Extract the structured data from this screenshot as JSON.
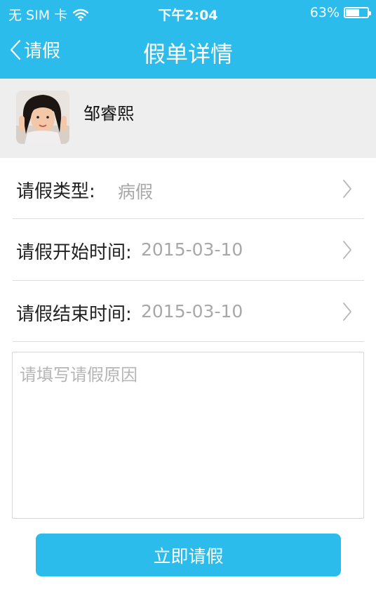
{
  "status_bar": {
    "carrier": "无 SIM 卡",
    "time": "下午2:04",
    "battery": "63%",
    "battery_level": 0.63
  },
  "nav": {
    "back_label": "请假",
    "title": "假单详情"
  },
  "user": {
    "name": "邹睿熙"
  },
  "form": {
    "type": {
      "label": "请假类型:",
      "value": "病假"
    },
    "start": {
      "label": "请假开始时间:",
      "value": "2015-03-10"
    },
    "end": {
      "label": "请假结束时间:",
      "value": "2015-03-10"
    },
    "reason_placeholder": "请填写请假原因",
    "submit_label": "立即请假"
  },
  "colors": {
    "accent": "#2bbcec",
    "strip": "#eeeeee",
    "muted_text": "#a8a8a8"
  }
}
